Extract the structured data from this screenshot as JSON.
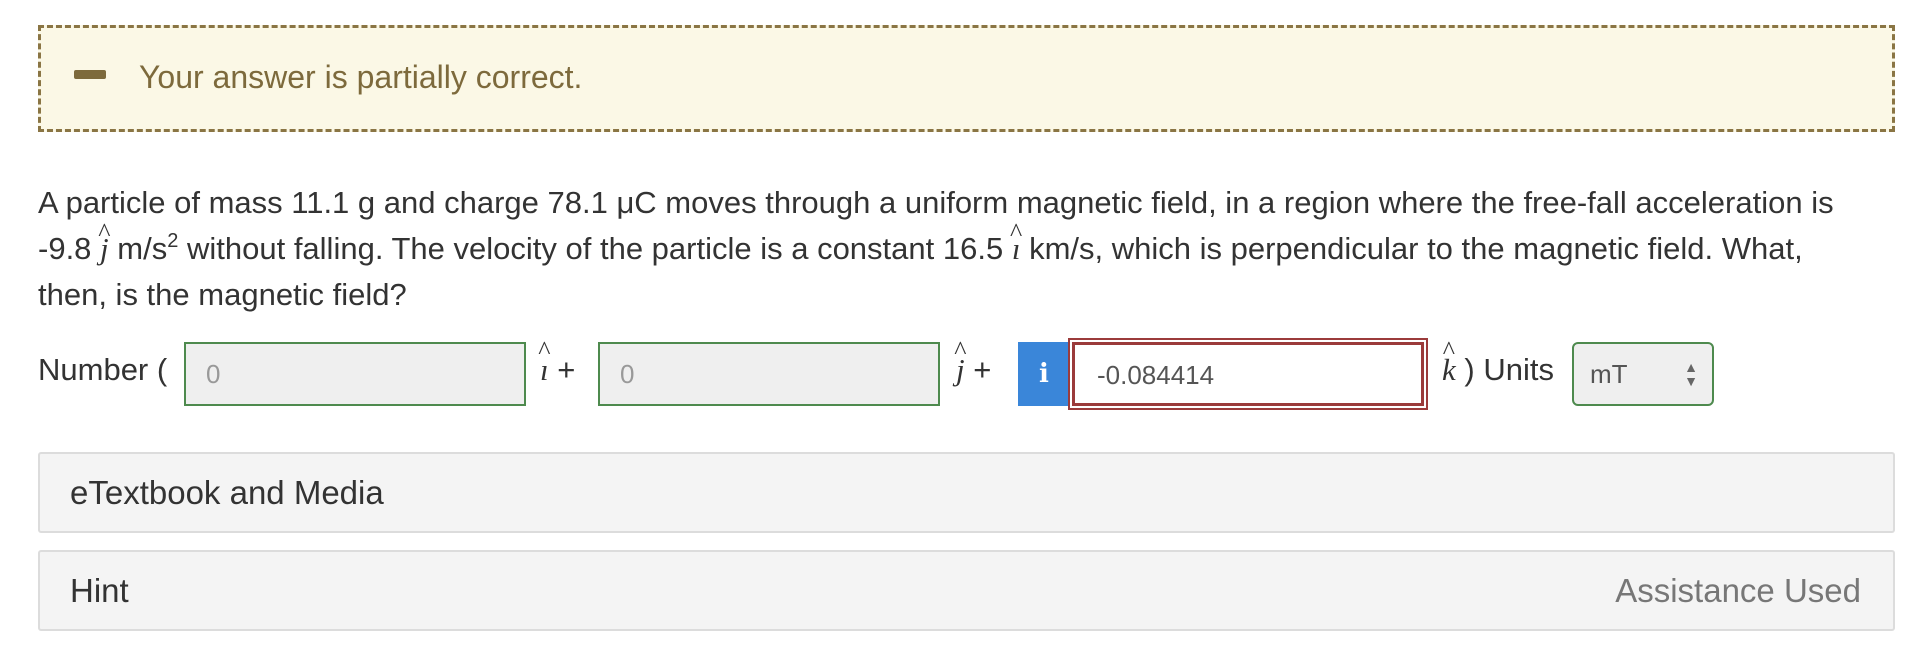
{
  "banner": {
    "message": "Your answer is partially correct."
  },
  "question": {
    "line1": "A particle of mass 11.1 g and charge 78.1 μC moves through a uniform magnetic field, in a region where the free-fall acceleration is",
    "accel_value": "-9.8",
    "accel_unit": "m/s",
    "accel_exp": "2",
    "line2_mid": "without falling. The velocity of the particle is a constant 16.5",
    "velocity_unit": "km/s, which is perpendicular to the magnetic field. What,",
    "line3": "then, is the magnetic field?"
  },
  "answer": {
    "prefix": "Number (",
    "i_component": {
      "placeholder": "0",
      "value": ""
    },
    "j_component": {
      "placeholder": "0",
      "value": ""
    },
    "k_component": {
      "value": "-0.084414",
      "status": "incorrect"
    },
    "plus": "+",
    "suffix": ") Units",
    "info_icon_char": "i",
    "units": {
      "selected": "mT"
    },
    "unit_vectors": {
      "i": "ı",
      "j": "j",
      "k": "k"
    }
  },
  "panels": [
    {
      "title": "eTextbook and Media",
      "right_text": ""
    },
    {
      "title": "Hint",
      "right_text": "Assistance Used"
    }
  ],
  "colors": {
    "banner_bg": "#fbf8e6",
    "banner_text": "#7d6a3c",
    "correct_border": "#4e8a4e",
    "incorrect_border": "#9b3b3b",
    "info_button": "#3a86d9"
  }
}
